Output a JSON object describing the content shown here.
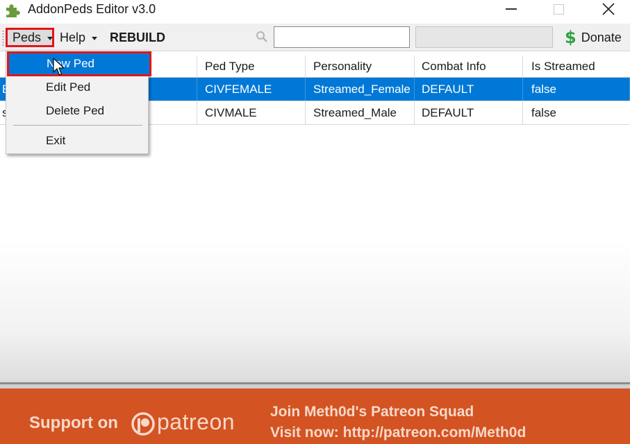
{
  "window": {
    "title": "AddonPeds Editor v3.0"
  },
  "toolbar": {
    "peds_label": "Peds",
    "help_label": "Help",
    "rebuild_label": "REBUILD",
    "search_value": "",
    "donate_label": "Donate"
  },
  "grid": {
    "columns": [
      "",
      "Ped Type",
      "Personality",
      "Combat Info",
      "Is Streamed"
    ],
    "rows": [
      {
        "name": "E",
        "ped_type": "CIVFEMALE",
        "personality": "Streamed_Female",
        "combat": "DEFAULT",
        "streamed": "false",
        "selected": true
      },
      {
        "name": "s",
        "ped_type": "CIVMALE",
        "personality": "Streamed_Male",
        "combat": "DEFAULT",
        "streamed": "false",
        "selected": false
      }
    ]
  },
  "menu": {
    "items": [
      "New Ped",
      "Edit Ped",
      "Delete Ped",
      "Exit"
    ],
    "highlighted": "New Ped"
  },
  "banner": {
    "support": "Support on",
    "brand": "patreon",
    "join": "Join Meth0d's Patreon Squad",
    "visit": "Visit now: http://patreon.com/Meth0d"
  },
  "colors": {
    "selection": "#0078d7",
    "highlight_border": "#e3141b",
    "banner": "#d35322",
    "donate_icon": "#2fa341"
  },
  "icons": [
    "puzzle-icon",
    "minimize-icon",
    "maximize-icon",
    "close-icon",
    "search-icon",
    "dollar-icon",
    "patreon-logo-icon",
    "cursor-icon"
  ]
}
